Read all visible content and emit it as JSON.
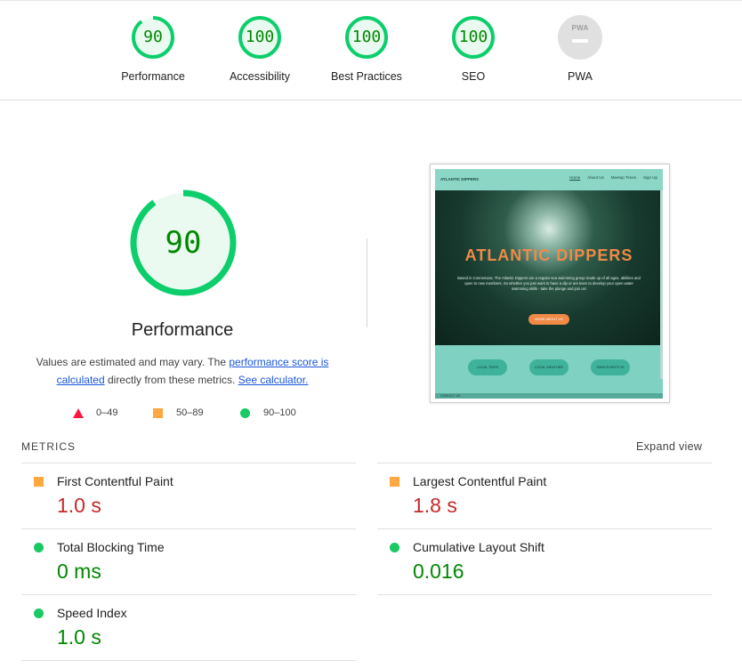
{
  "colors": {
    "pass": "#0cce6b",
    "pass_text": "#008800",
    "average": "#ffa400",
    "fail": "#ff4e42",
    "metric_value_orange": "#c62828",
    "link": "#1a56db"
  },
  "summary": [
    {
      "label": "Performance",
      "score": "90",
      "score_value": 90
    },
    {
      "label": "Accessibility",
      "score": "100",
      "score_value": 100
    },
    {
      "label": "Best Practices",
      "score": "100",
      "score_value": 100
    },
    {
      "label": "SEO",
      "score": "100",
      "score_value": 100
    },
    {
      "label": "PWA",
      "badge": "PWA",
      "icon": "pwa-badge-icon"
    }
  ],
  "main": {
    "score": "90",
    "score_value": 90,
    "title": "Performance",
    "desc_prefix": "Values are estimated and may vary. The ",
    "desc_link1": "performance score is calculated",
    "desc_middle": " directly from these metrics. ",
    "desc_link2": "See calculator.",
    "legend": [
      {
        "icon": "triangle-icon",
        "label": "0–49"
      },
      {
        "icon": "square-icon",
        "label": "50–89"
      },
      {
        "icon": "circle-icon",
        "label": "90–100"
      }
    ]
  },
  "thumbnail": {
    "brand": "ATLANTIC DIPPERS",
    "nav": [
      "Home",
      "About Us",
      "Meetup Times",
      "Sign Up"
    ],
    "hero_title": "ATLANTIC DIPPERS",
    "hero_text": "Based in Connemara, The Atlantic Dippers are a regular sea swimming group made up of all ages, abilities and open to new members. So whether you just want to have a dip or are keen to develop your open water swimming skills - take the plunge and join us!",
    "hero_button": "MORE ABOUT US",
    "pills": [
      "LOCAL TIDES",
      "LOCAL WEATHER",
      "SWIM EVENTS IE"
    ],
    "footer": "CONTACT US"
  },
  "metrics": {
    "heading": "METRICS",
    "expand_label": "Expand view",
    "items": [
      {
        "name": "First Contentful Paint",
        "value": "1.0 s",
        "rating": "average",
        "icon": "square-icon"
      },
      {
        "name": "Largest Contentful Paint",
        "value": "1.8 s",
        "rating": "average",
        "icon": "square-icon"
      },
      {
        "name": "Total Blocking Time",
        "value": "0 ms",
        "rating": "pass",
        "icon": "circle-icon"
      },
      {
        "name": "Cumulative Layout Shift",
        "value": "0.016",
        "rating": "pass",
        "icon": "circle-icon"
      },
      {
        "name": "Speed Index",
        "value": "1.0 s",
        "rating": "pass",
        "icon": "circle-icon"
      }
    ]
  }
}
